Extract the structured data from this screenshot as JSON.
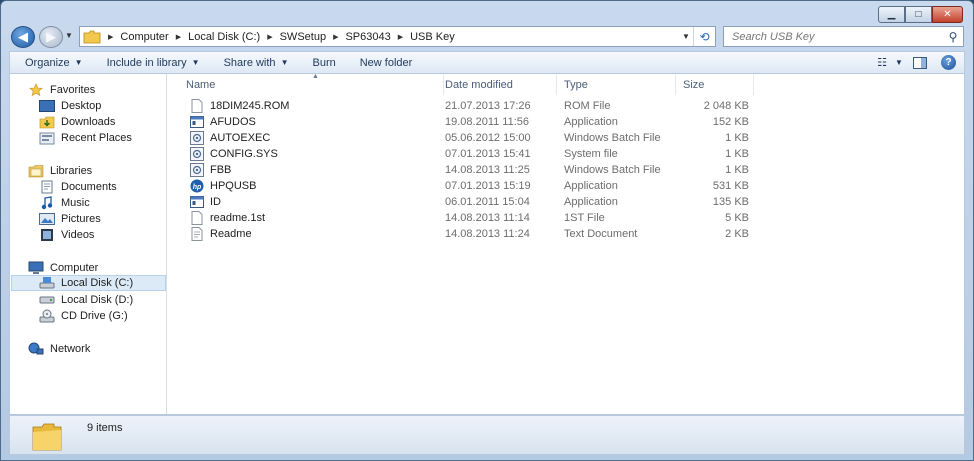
{
  "window": {
    "minimize_label": "▁",
    "maximize_label": "□",
    "close_label": "✕"
  },
  "navbar": {
    "back_label": "◀",
    "forward_label": "▶",
    "breadcrumb": [
      "Computer",
      "Local Disk (C:)",
      "SWSetup",
      "SP63043",
      "USB Key"
    ],
    "search_placeholder": "Search USB Key"
  },
  "toolbar": {
    "organize_label": "Organize",
    "include_label": "Include in library",
    "share_label": "Share with",
    "burn_label": "Burn",
    "new_folder_label": "New folder"
  },
  "sidebar": {
    "favorites": {
      "label": "Favorites",
      "items": [
        "Desktop",
        "Downloads",
        "Recent Places"
      ]
    },
    "libraries": {
      "label": "Libraries",
      "items": [
        "Documents",
        "Music",
        "Pictures",
        "Videos"
      ]
    },
    "computer": {
      "label": "Computer",
      "items": [
        "Local Disk (C:)",
        "Local Disk (D:)",
        "CD Drive (G:)"
      ],
      "selected": "Local Disk (C:)"
    },
    "network": {
      "label": "Network"
    }
  },
  "columns": [
    "Name",
    "Date modified",
    "Type",
    "Size"
  ],
  "files": [
    {
      "name": "18DIM245.ROM",
      "date": "21.07.2013 17:26",
      "type": "ROM File",
      "size": "2 048 KB",
      "icon": "document-icon"
    },
    {
      "name": "AFUDOS",
      "date": "19.08.2011 11:56",
      "type": "Application",
      "size": "152 KB",
      "icon": "application-icon"
    },
    {
      "name": "AUTOEXEC",
      "date": "05.06.2012 15:00",
      "type": "Windows Batch File",
      "size": "1 KB",
      "icon": "batch-file-icon"
    },
    {
      "name": "CONFIG.SYS",
      "date": "07.01.2013 15:41",
      "type": "System file",
      "size": "1 KB",
      "icon": "system-file-icon"
    },
    {
      "name": "FBB",
      "date": "14.08.2013 11:25",
      "type": "Windows Batch File",
      "size": "1 KB",
      "icon": "batch-file-icon"
    },
    {
      "name": "HPQUSB",
      "date": "07.01.2013 15:19",
      "type": "Application",
      "size": "531 KB",
      "icon": "hp-logo-icon"
    },
    {
      "name": "ID",
      "date": "06.01.2011 15:04",
      "type": "Application",
      "size": "135 KB",
      "icon": "application-icon"
    },
    {
      "name": "readme.1st",
      "date": "14.08.2013 11:14",
      "type": "1ST File",
      "size": "5 KB",
      "icon": "document-icon"
    },
    {
      "name": "Readme",
      "date": "14.08.2013 11:24",
      "type": "Text Document",
      "size": "2 KB",
      "icon": "text-document-icon"
    }
  ],
  "status": {
    "item_count": "9 items"
  },
  "colors": {
    "accent": "#1d5aa6",
    "selection": "#dce9f6",
    "folder": "#f2c94c"
  }
}
